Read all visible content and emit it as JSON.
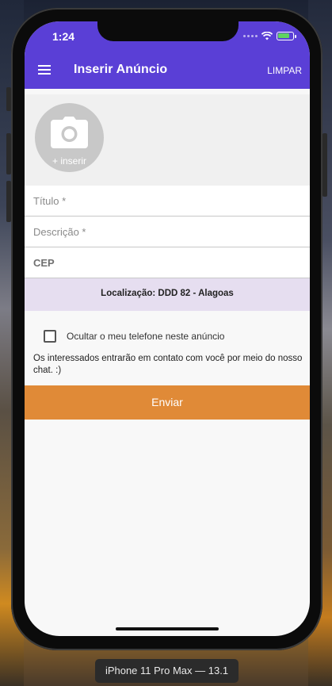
{
  "status_bar": {
    "time": "1:24"
  },
  "app_bar": {
    "title": "Inserir Anúncio",
    "clear_label": "LIMPAR",
    "menu_icon": "hamburger-menu-icon"
  },
  "photo": {
    "icon": "camera-icon",
    "insert_label": "+ inserir"
  },
  "form": {
    "title_placeholder": "Título *",
    "description_placeholder": "Descrição *",
    "cep_label": "CEP"
  },
  "location": {
    "text": "Localização: DDD 82 - Alagoas"
  },
  "options": {
    "hide_phone_label": "Ocultar o meu telefone neste anúncio",
    "hide_phone_checked": false,
    "info_text": "Os interessados entrarão em contato com você por meio do nosso chat. :)"
  },
  "submit": {
    "label": "Enviar"
  },
  "colors": {
    "app_bar": "#5a3fd6",
    "submit": "#e08a37",
    "location_bg": "#e6def0"
  },
  "device_label": "iPhone 11 Pro Max — 13.1"
}
